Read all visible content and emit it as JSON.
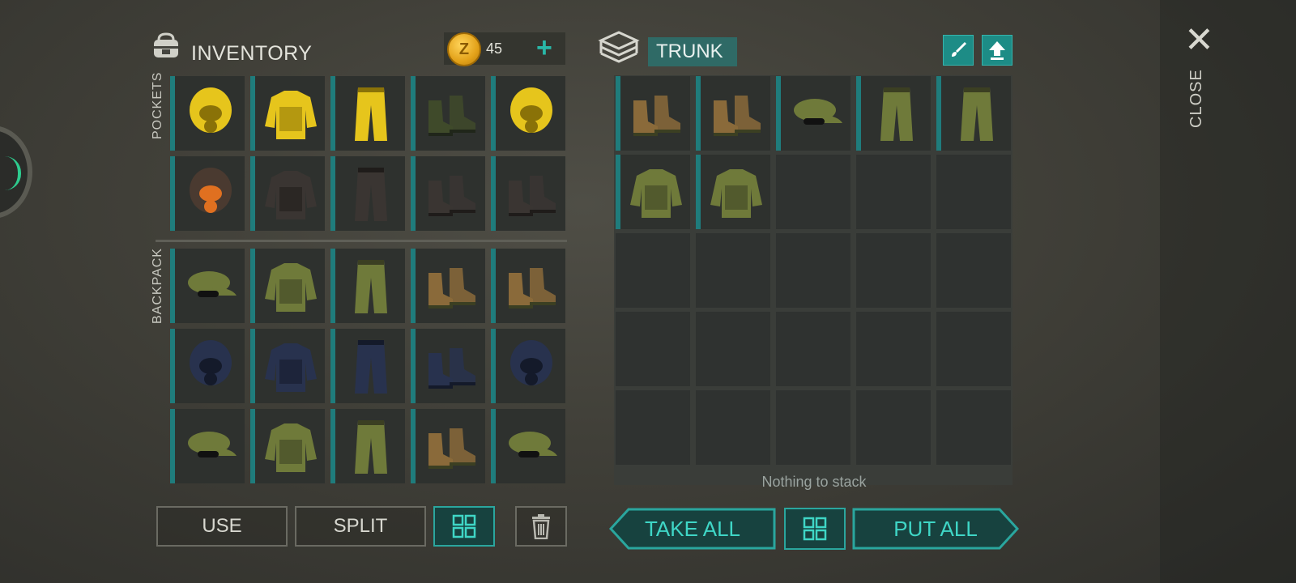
{
  "inventory": {
    "title": "INVENTORY",
    "currency_value": "45",
    "currency_symbol": "Z",
    "add_label": "+",
    "pockets_label": "POCKETS",
    "backpack_label": "BACKPACK",
    "pockets": [
      {
        "icon": "hazmat-hood-icon"
      },
      {
        "icon": "hazmat-jacket-icon"
      },
      {
        "icon": "hazmat-pants-icon"
      },
      {
        "icon": "rubber-boots-icon"
      },
      {
        "icon": "hazmat-hood-icon"
      },
      {
        "icon": "spiked-gas-mask-icon"
      },
      {
        "icon": "armored-vest-icon"
      },
      {
        "icon": "armored-pants-icon"
      },
      {
        "icon": "armored-boots-icon"
      },
      {
        "icon": "combat-boots-icon"
      }
    ],
    "backpack": [
      {
        "icon": "camo-cap-icon"
      },
      {
        "icon": "camo-vest-icon"
      },
      {
        "icon": "camo-pants-icon"
      },
      {
        "icon": "desert-boots-icon"
      },
      {
        "icon": "desert-boots-icon"
      },
      {
        "icon": "tactical-helmet-icon"
      },
      {
        "icon": "police-vest-icon"
      },
      {
        "icon": "police-pants-icon"
      },
      {
        "icon": "police-boots-icon"
      },
      {
        "icon": "tactical-helmet-icon"
      },
      {
        "icon": "camo-cap-icon"
      },
      {
        "icon": "camo-vest-icon"
      },
      {
        "icon": "camo-pants-icon"
      },
      {
        "icon": "desert-boots-icon"
      },
      {
        "icon": "camo-cap-icon"
      }
    ]
  },
  "trunk": {
    "title": "TRUNK",
    "items": [
      {
        "icon": "desert-boots-icon"
      },
      {
        "icon": "desert-boots-icon"
      },
      {
        "icon": "camo-cap-icon"
      },
      {
        "icon": "camo-pants-icon"
      },
      {
        "icon": "camo-pants-icon"
      },
      {
        "icon": "camo-vest-icon"
      },
      {
        "icon": "camo-vest-icon"
      }
    ],
    "empty_message": "Nothing to stack"
  },
  "buttons": {
    "use": "USE",
    "split": "SPLIT",
    "take_all": "TAKE ALL",
    "put_all": "PUT ALL",
    "close": "CLOSE"
  },
  "colors": {
    "accent": "#1d8c86",
    "slot": "#2e312e",
    "hazmat": "#e6c51c",
    "camo": "#6f7a3a",
    "police": "#28324e",
    "leather": "#8a6a3a",
    "armor": "#3a3532"
  }
}
